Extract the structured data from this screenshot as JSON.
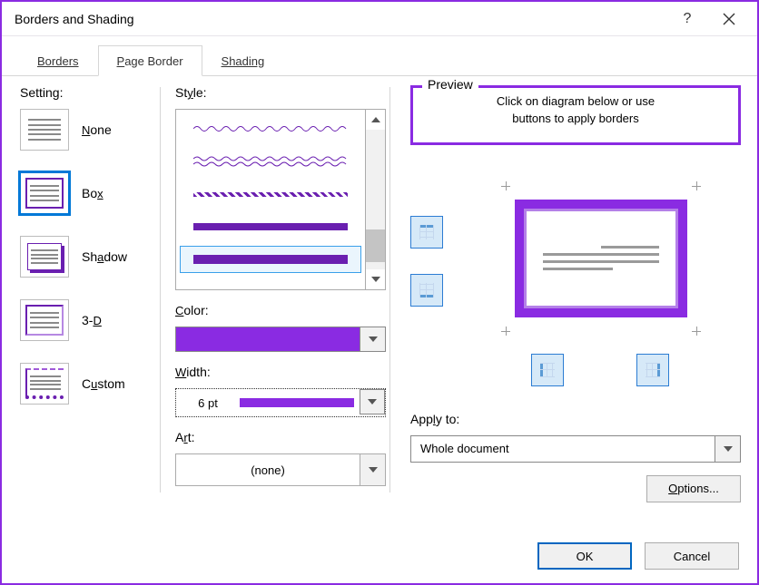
{
  "title": "Borders and Shading",
  "tabs": {
    "borders": "Borders",
    "page_border": "Page Border",
    "shading": "Shading"
  },
  "setting": {
    "label": "Setting:",
    "none": "None",
    "box": "Box",
    "shadow": "Shadow",
    "threeD": "3-D",
    "custom": "Custom"
  },
  "style": {
    "label": "Style:",
    "color_label": "Color:",
    "color_value": "#8A2BE2",
    "width_label": "Width:",
    "width_value": "6 pt",
    "art_label": "Art:",
    "art_value": "(none)"
  },
  "preview": {
    "legend": "Preview",
    "hint_l1": "Click on diagram below or use",
    "hint_l2": "buttons to apply borders"
  },
  "apply": {
    "label": "Apply to:",
    "value": "Whole document"
  },
  "buttons": {
    "options": "Options...",
    "ok": "OK",
    "cancel": "Cancel"
  }
}
